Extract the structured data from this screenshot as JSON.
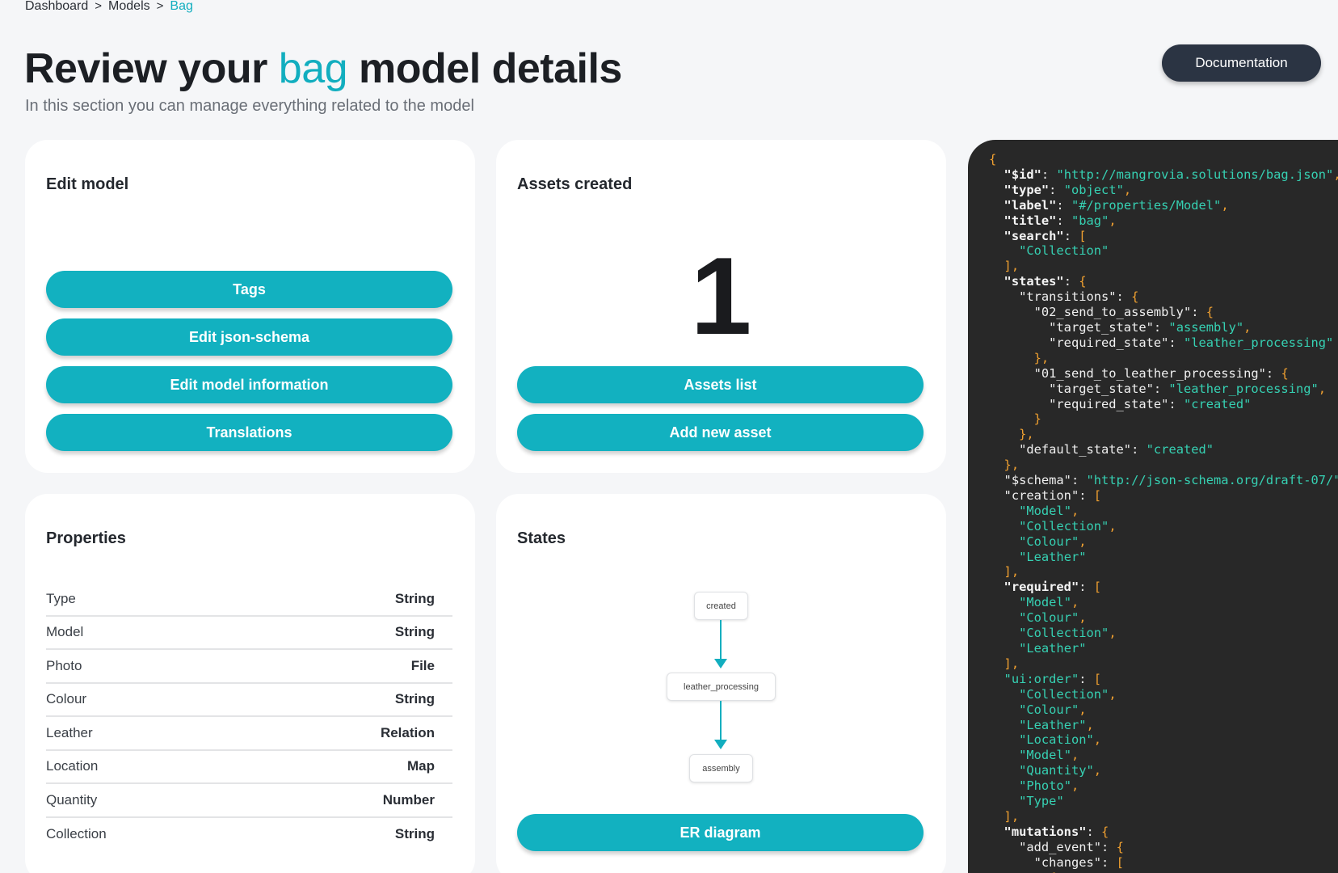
{
  "breadcrumb": {
    "items": [
      "Dashboard",
      "Models",
      "Bag"
    ],
    "separator": ">"
  },
  "header": {
    "title_prefix": "Review your",
    "title_accent": "bag",
    "title_suffix": "model details",
    "subtitle": "In this section you can manage everything related to the model",
    "documentation_label": "Documentation"
  },
  "edit_model": {
    "title": "Edit model",
    "buttons": [
      "Tags",
      "Edit json-schema",
      "Edit model information",
      "Translations"
    ]
  },
  "assets": {
    "title": "Assets created",
    "count": "1",
    "buttons": [
      "Assets list",
      "Add new asset"
    ]
  },
  "properties": {
    "title": "Properties",
    "rows": [
      {
        "name": "Type",
        "type": "String"
      },
      {
        "name": "Model",
        "type": "String"
      },
      {
        "name": "Photo",
        "type": "File"
      },
      {
        "name": "Colour",
        "type": "String"
      },
      {
        "name": "Leather",
        "type": "Relation"
      },
      {
        "name": "Location",
        "type": "Map"
      },
      {
        "name": "Quantity",
        "type": "Number"
      },
      {
        "name": "Collection",
        "type": "String"
      }
    ]
  },
  "states": {
    "title": "States",
    "nodes": [
      "created",
      "leather_processing",
      "assembly"
    ],
    "er_button": "ER diagram"
  },
  "json_schema": {
    "id": "http://mangrovia.solutions/bag.json",
    "type": "object",
    "label": "#/properties/Model",
    "title": "bag",
    "search": [
      "Collection"
    ],
    "transition_1": "02_send_to_assembly",
    "transition_1_target": "assembly",
    "transition_1_required": "leather_processing",
    "transition_2": "01_send_to_leather_processing",
    "transition_2_target": "leather_processing",
    "transition_2_required": "created",
    "default_state": "created",
    "schema": "http://json-schema.org/draft-07/",
    "creation": [
      "Model",
      "Collection",
      "Colour",
      "Leather"
    ],
    "required": [
      "Model",
      "Colour",
      "Collection",
      "Leather"
    ],
    "ui_order": [
      "Collection",
      "Colour",
      "Leather",
      "Location",
      "Model",
      "Quantity",
      "Photo",
      "Type"
    ],
    "mutation_1": "add_event",
    "mutation_1_key": "changes"
  },
  "colors": {
    "accent": "#12aebf",
    "dark_button": "#2b3443",
    "code_bg": "#282828"
  }
}
